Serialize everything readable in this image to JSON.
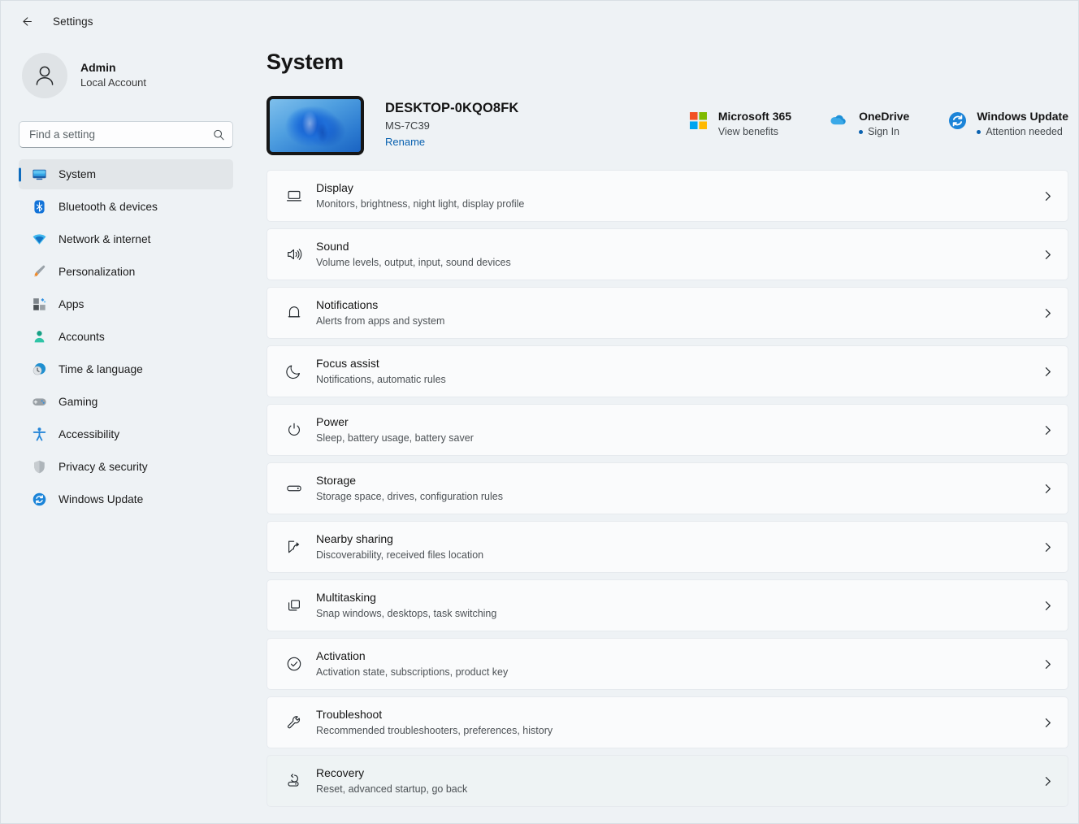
{
  "window": {
    "title": "Settings",
    "back_icon": "arrow-left-icon"
  },
  "account": {
    "name": "Admin",
    "subtitle": "Local Account",
    "avatar_icon": "person-icon"
  },
  "search": {
    "placeholder": "Find a setting",
    "value": "",
    "icon": "search-icon"
  },
  "sidebar": {
    "items": [
      {
        "label": "System",
        "icon": "monitor-icon",
        "selected": true
      },
      {
        "label": "Bluetooth & devices",
        "icon": "bluetooth-icon",
        "selected": false
      },
      {
        "label": "Network & internet",
        "icon": "wifi-icon",
        "selected": false
      },
      {
        "label": "Personalization",
        "icon": "paintbrush-icon",
        "selected": false
      },
      {
        "label": "Apps",
        "icon": "apps-icon",
        "selected": false
      },
      {
        "label": "Accounts",
        "icon": "person-badge-icon",
        "selected": false
      },
      {
        "label": "Time & language",
        "icon": "clock-globe-icon",
        "selected": false
      },
      {
        "label": "Gaming",
        "icon": "gamepad-icon",
        "selected": false
      },
      {
        "label": "Accessibility",
        "icon": "accessibility-person-icon",
        "selected": false
      },
      {
        "label": "Privacy & security",
        "icon": "shield-icon",
        "selected": false
      },
      {
        "label": "Windows Update",
        "icon": "update-refresh-icon",
        "selected": false
      }
    ]
  },
  "page": {
    "title": "System"
  },
  "device": {
    "name": "DESKTOP-0KQO8FK",
    "model": "MS-7C39",
    "rename_label": "Rename",
    "thumbnail_icon": "windows-bloom-wallpaper"
  },
  "status_cards": [
    {
      "title": "Microsoft 365",
      "subtitle": "View benefits",
      "icon": "microsoft-logo-icon",
      "has_dot": false
    },
    {
      "title": "OneDrive",
      "subtitle": "Sign In",
      "icon": "onedrive-cloud-icon",
      "has_dot": true
    },
    {
      "title": "Windows Update",
      "subtitle": "Attention needed",
      "icon": "update-refresh-icon",
      "has_dot": true
    }
  ],
  "settings_rows": [
    {
      "title": "Display",
      "subtitle": "Monitors, brightness, night light, display profile",
      "icon": "monitor-icon",
      "hovered": false
    },
    {
      "title": "Sound",
      "subtitle": "Volume levels, output, input, sound devices",
      "icon": "speaker-icon",
      "hovered": false
    },
    {
      "title": "Notifications",
      "subtitle": "Alerts from apps and system",
      "icon": "bell-icon",
      "hovered": false
    },
    {
      "title": "Focus assist",
      "subtitle": "Notifications, automatic rules",
      "icon": "moon-icon",
      "hovered": false
    },
    {
      "title": "Power",
      "subtitle": "Sleep, battery usage, battery saver",
      "icon": "power-icon",
      "hovered": false
    },
    {
      "title": "Storage",
      "subtitle": "Storage space, drives, configuration rules",
      "icon": "drive-icon",
      "hovered": false
    },
    {
      "title": "Nearby sharing",
      "subtitle": "Discoverability, received files location",
      "icon": "share-icon",
      "hovered": false
    },
    {
      "title": "Multitasking",
      "subtitle": "Snap windows, desktops, task switching",
      "icon": "windows-stack-icon",
      "hovered": false
    },
    {
      "title": "Activation",
      "subtitle": "Activation state, subscriptions, product key",
      "icon": "check-circle-icon",
      "hovered": false
    },
    {
      "title": "Troubleshoot",
      "subtitle": "Recommended troubleshooters, preferences, history",
      "icon": "wrench-icon",
      "hovered": false
    },
    {
      "title": "Recovery",
      "subtitle": "Reset, advanced startup, go back",
      "icon": "recovery-icon",
      "hovered": true
    }
  ],
  "colors": {
    "background": "#eef2f5",
    "card": "#fafbfc",
    "accent": "#0f6cbd",
    "link": "#0a62b0"
  }
}
